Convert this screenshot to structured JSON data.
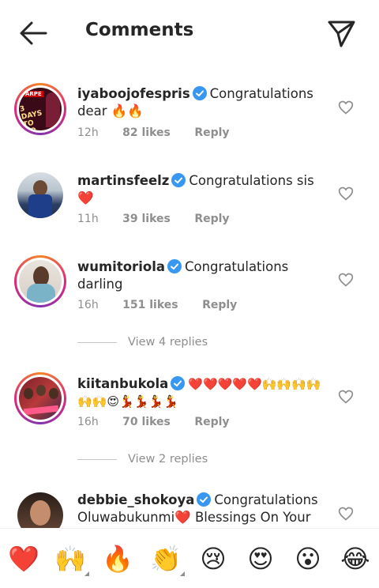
{
  "header": {
    "title": "Comments"
  },
  "comments": [
    {
      "username": "iyaboojofespris",
      "text": "Congratulations dear 🔥🔥",
      "time": "12h",
      "likes": "82 likes",
      "reply": "Reply",
      "avatar_text": "3 DAYS TO GO",
      "avatar_top_text": "ARPE"
    },
    {
      "username": "martinsfeelz",
      "text": "Congratulations sis ❤️",
      "time": "11h",
      "likes": "39 likes",
      "reply": "Reply"
    },
    {
      "username": "wumitoriola",
      "text": "Congratulations darling",
      "time": "16h",
      "likes": "151 likes",
      "reply": "Reply"
    },
    {
      "username": "kiitanbukola",
      "text": "❤️❤️❤️❤️❤️🙌🙌🙌🙌🙌🙌😍💃💃💃💃",
      "time": "16h",
      "likes": "70 likes",
      "reply": "Reply"
    },
    {
      "username": "debbie_shokoya",
      "text": "Congratulations Oluwabukunmi❤️ Blessings On Your"
    }
  ],
  "view_replies": [
    "View 4 replies",
    "View 2 replies"
  ],
  "emoji_bar": [
    {
      "icon": "red-heart",
      "glyph": "❤️"
    },
    {
      "icon": "raising-hands",
      "glyph": "🙌"
    },
    {
      "icon": "fire",
      "glyph": "🔥"
    },
    {
      "icon": "clapping-hands",
      "glyph": "👏"
    },
    {
      "icon": "crying-face",
      "glyph": "😢"
    },
    {
      "icon": "heart-eyes",
      "glyph": "😍"
    },
    {
      "icon": "surprised-face",
      "glyph": "😮"
    },
    {
      "icon": "tears-of-joy",
      "glyph": "😂"
    }
  ],
  "colors": {
    "text": "#262626",
    "muted": "#8e8e8e",
    "verified": "#3897f0",
    "ring_start": "#f58529",
    "ring_mid": "#dd2a7b"
  }
}
